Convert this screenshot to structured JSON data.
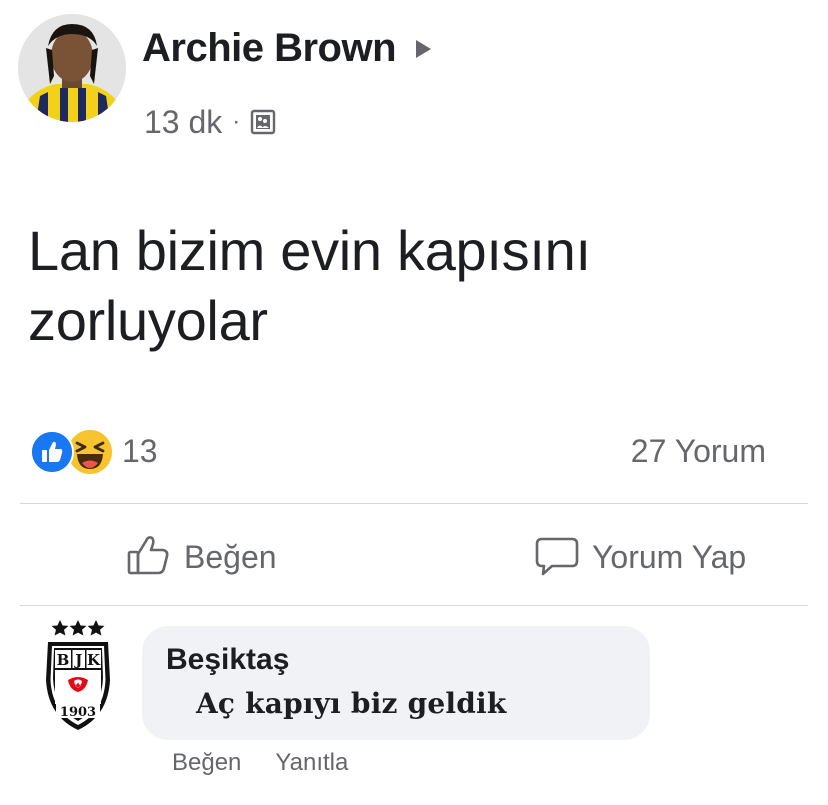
{
  "post": {
    "author": "Archie Brown",
    "time": "13 dk",
    "separator": "·",
    "audience_icon": "photo-album-icon",
    "text_line1": "Lan bizim evin kapısını",
    "text_line2": "zorluyolar",
    "reaction_count": "13",
    "reaction_types": [
      "like",
      "haha"
    ],
    "comment_count": "27 Yorum"
  },
  "actions": {
    "like_label": "Beğen",
    "comment_label": "Yorum Yap"
  },
  "comment": {
    "author": "Beşiktaş",
    "text": "Aç kapıyı biz geldik",
    "like_label": "Beğen",
    "reply_label": "Yanıtla",
    "logo_letters": [
      "B",
      "J",
      "K"
    ],
    "logo_year": "1903"
  },
  "colors": {
    "facebook_blue": "#1877f2",
    "haha_yellow": "#f7c430",
    "secondary_text": "#65676b",
    "bubble_bg": "#f0f2f5",
    "jersey_yellow": "#f3d11b",
    "jersey_navy": "#1d2a5e"
  }
}
